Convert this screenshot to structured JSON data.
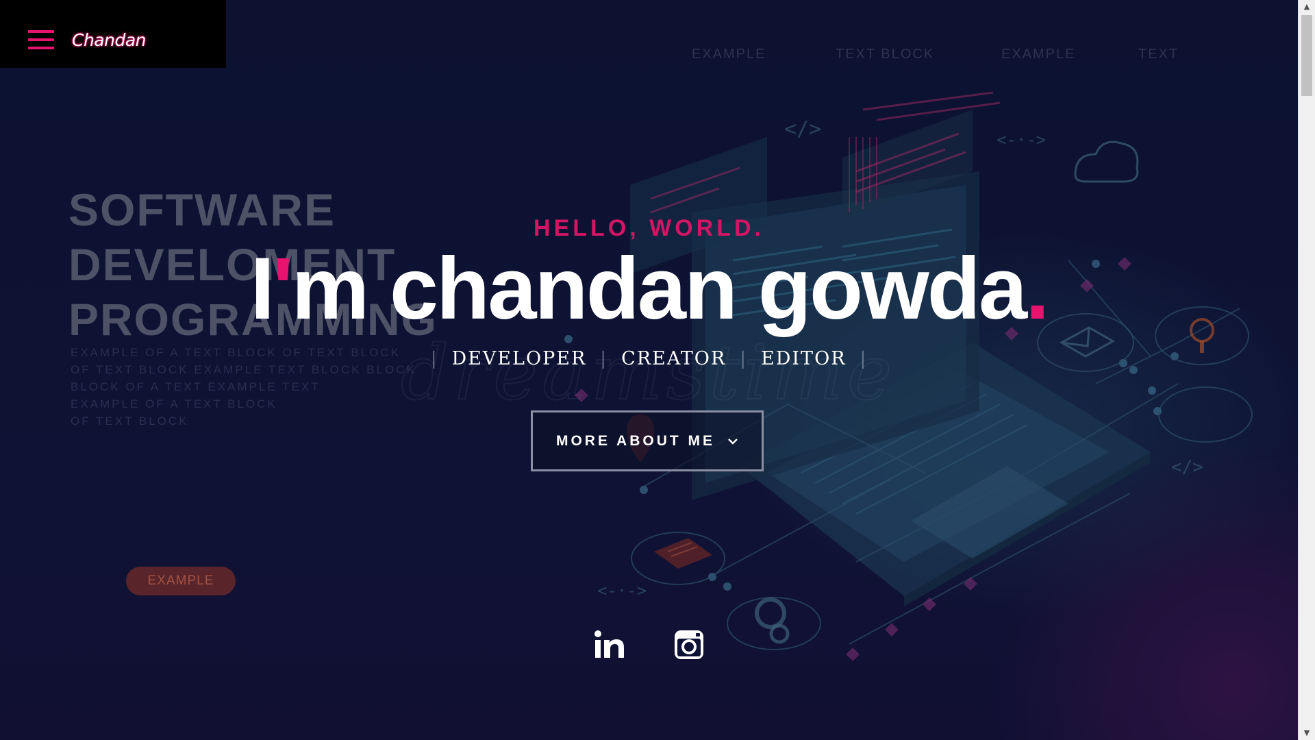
{
  "header": {
    "brand": "Chandan"
  },
  "background": {
    "nav": [
      "EXAMPLE",
      "TEXT BLOCK",
      "EXAMPLE",
      "TEXT"
    ],
    "headline_lines": [
      "SOFTWARE",
      "DEVELOMENT",
      "PROGRAMMING"
    ],
    "small_lines": [
      "EXAMPLE OF A TEXT BLOCK OF TEXT BLOCK",
      "OF TEXT BLOCK EXAMPLE TEXT BLOCK BLOCK",
      "BLOCK OF A TEXT EXAMPLE TEXT",
      "EXAMPLE OF A TEXT BLOCK",
      "OF TEXT BLOCK"
    ],
    "pill": "EXAMPLE",
    "cursive": "dreamstime"
  },
  "hero": {
    "greeting": "HELLO, WORLD.",
    "headline_prefix": "I",
    "headline_apostrophe": "'",
    "headline_rest": "m chandan gowda",
    "headline_dot": ".",
    "roles": [
      "DEVELOPER",
      "CREATOR",
      "EDITOR"
    ],
    "cta_label": "MORE ABOUT ME"
  },
  "social": {
    "icons": [
      "linkedin-icon",
      "instagram-icon"
    ]
  },
  "colors": {
    "accent": "#e8126f",
    "greeting": "#d21565",
    "background": "#0d1230",
    "header_bg": "#000000"
  }
}
